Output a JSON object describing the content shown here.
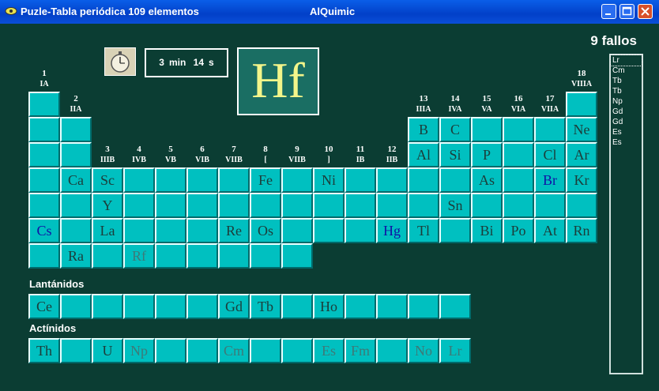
{
  "window": {
    "title": "Puzle-Tabla periódica 109 elementos",
    "subtitle": "AlQuimic",
    "icon": "app-icon"
  },
  "fallos": "9 fallos",
  "timer": {
    "min_value": "3",
    "min_unit": "min",
    "sec_value": "14",
    "sec_unit": "s"
  },
  "current_element": "Hf",
  "groups": [
    {
      "n": "1",
      "r": "IA"
    },
    {
      "n": "2",
      "r": "IIA"
    },
    {
      "n": "3",
      "r": "IIIB"
    },
    {
      "n": "4",
      "r": "IVB"
    },
    {
      "n": "5",
      "r": "VB"
    },
    {
      "n": "6",
      "r": "VIB"
    },
    {
      "n": "7",
      "r": "VIIB"
    },
    {
      "n": "8",
      "r": "["
    },
    {
      "n": "9",
      "r": "VIIB"
    },
    {
      "n": "10",
      "r": "]"
    },
    {
      "n": "11",
      "r": "IB"
    },
    {
      "n": "12",
      "r": "IIB"
    },
    {
      "n": "13",
      "r": "IIIA"
    },
    {
      "n": "14",
      "r": "IVA"
    },
    {
      "n": "15",
      "r": "VA"
    },
    {
      "n": "16",
      "r": "VIA"
    },
    {
      "n": "17",
      "r": "VIIA"
    },
    {
      "n": "18",
      "r": "VIIIA"
    }
  ],
  "sections": {
    "lanthanides": "Lantánidos",
    "actinides": "Actínidos"
  },
  "cells": {
    "r2": {
      "B": "B",
      "C": "C",
      "Ne": "Ne"
    },
    "r3": {
      "Al": "Al",
      "Si": "Si",
      "P": "P",
      "Cl": "Cl",
      "Ar": "Ar"
    },
    "r4": {
      "Ca": "Ca",
      "Sc": "Sc",
      "Fe": "Fe",
      "Ni": "Ni",
      "As": "As",
      "Br": "Br",
      "Kr": "Kr"
    },
    "r5": {
      "Y": "Y",
      "Sn": "Sn"
    },
    "r6": {
      "Cs": "Cs",
      "La": "La",
      "Re": "Re",
      "Os": "Os",
      "Hg": "Hg",
      "Tl": "Tl",
      "Bi": "Bi",
      "Po": "Po",
      "At": "At",
      "Rn": "Rn"
    },
    "r7": {
      "Ra": "Ra",
      "Rf": "Rf"
    },
    "lan": {
      "Ce": "Ce",
      "Gd": "Gd",
      "Tb": "Tb",
      "Ho": "Ho"
    },
    "act": {
      "Th": "Th",
      "U": "U",
      "Np": "Np",
      "Cm": "Cm",
      "Es": "Es",
      "Fm": "Fm",
      "No": "No",
      "Lr": "Lr"
    }
  },
  "error_list": [
    "Lr",
    "Cm",
    "Tb",
    "Tb",
    "Np",
    "Gd",
    "Gd",
    "Es",
    "Es"
  ],
  "colors": {
    "background": "#0b3d33",
    "cell": "#00c0c0",
    "symbol": "#f3f58a",
    "titlebar": "#0a5ee8"
  }
}
